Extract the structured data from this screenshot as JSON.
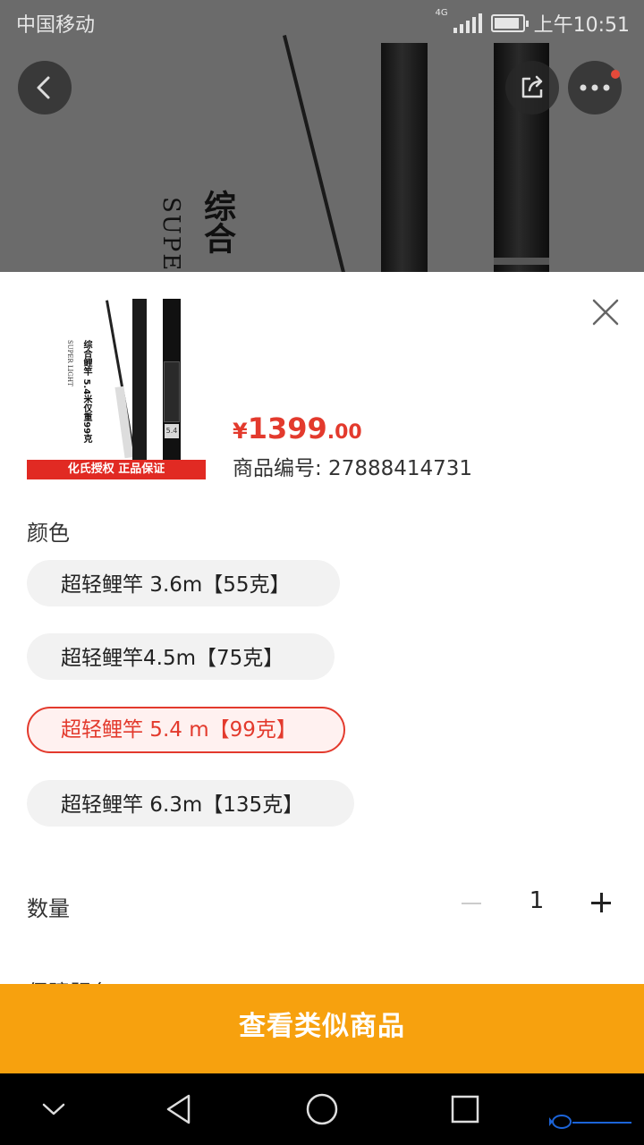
{
  "status_bar": {
    "carrier": "中国移动",
    "network": "4G",
    "time": "上午10:51",
    "battery_level": 0.9
  },
  "background": {
    "product_title_vertical": "综合",
    "product_subtitle_vertical": "SUPE"
  },
  "product": {
    "thumb_title": "综合鲤竿 5.4米仅重99克",
    "thumb_subtitle": "SUPER LIGHT",
    "thumb_banner": "化氏授权 正品保证",
    "price_currency": "¥",
    "price_integer": "1399",
    "price_decimal": ".00",
    "product_no": "商品编号: 27888414731"
  },
  "color": {
    "label": "颜色",
    "options": [
      {
        "label": "超轻鲤竿 3.6m【55克】",
        "selected": false
      },
      {
        "label": "超轻鲤竿4.5m【75克】",
        "selected": false
      },
      {
        "label": "超轻鲤竿 5.4 m【99克】",
        "selected": true
      },
      {
        "label": "超轻鲤竿 6.3m【135克】",
        "selected": false
      }
    ]
  },
  "quantity": {
    "label": "数量",
    "value": "1"
  },
  "service": {
    "label": "保障服务"
  },
  "cta": {
    "label": "查看类似商品"
  },
  "colors": {
    "accent_red": "#e33a2d",
    "cta_orange": "#f7a10e"
  },
  "icons": {
    "back": "chevron-left-icon",
    "share": "share-icon",
    "more": "more-icon",
    "close": "close-icon"
  }
}
